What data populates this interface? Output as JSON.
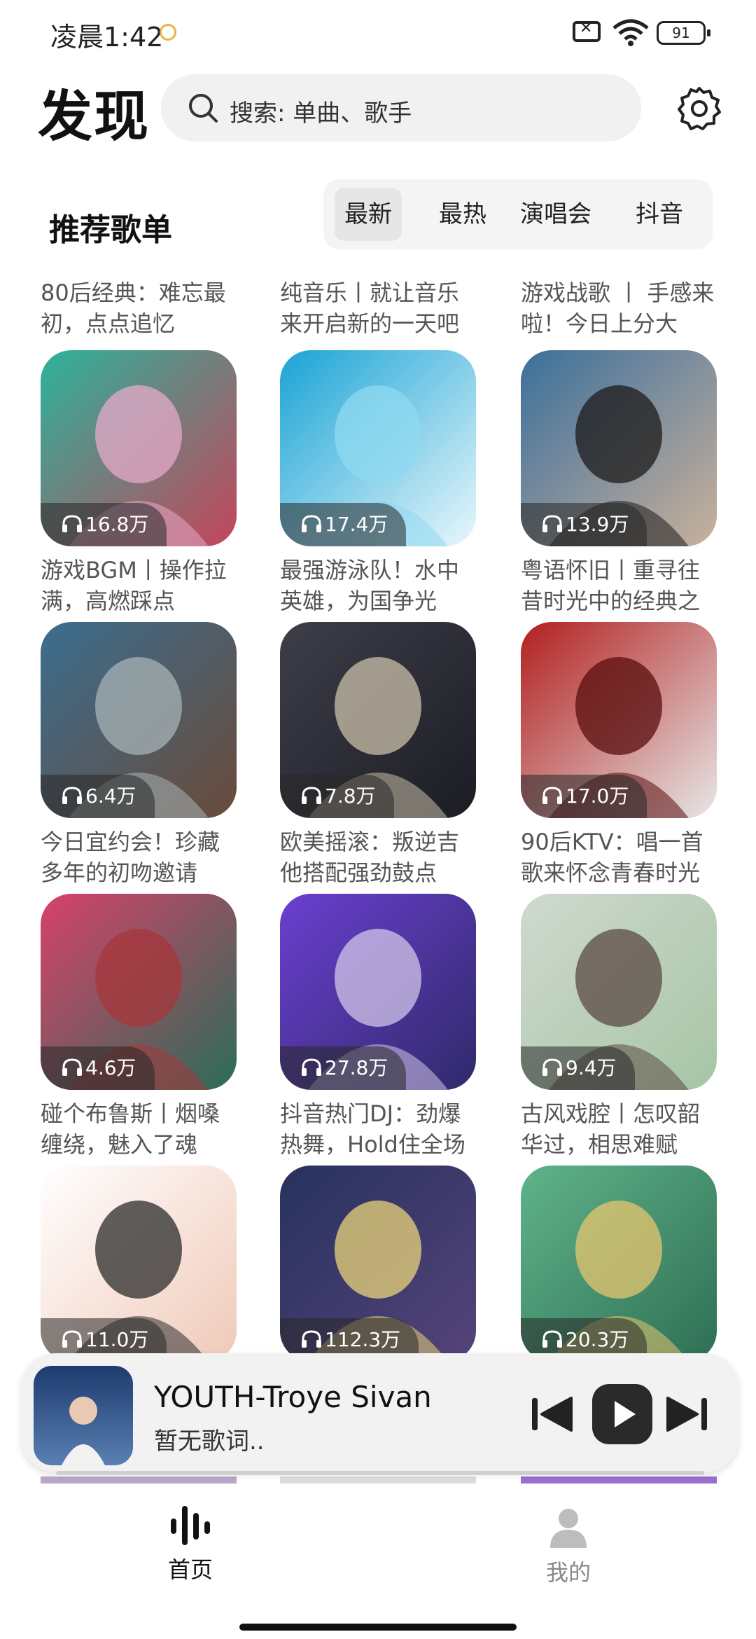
{
  "status_bar": {
    "time": "凌晨1:42",
    "battery": "91"
  },
  "header": {
    "title": "发现",
    "search_placeholder": "搜索: 单曲、歌手"
  },
  "section": {
    "title": "推荐歌单",
    "tabs": [
      {
        "label": "最新",
        "active": true
      },
      {
        "label": "最热",
        "active": false
      },
      {
        "label": "演唱会",
        "active": false
      },
      {
        "label": "抖音",
        "active": false
      }
    ]
  },
  "top_partial_row": [
    {
      "caption": "80后经典：难忘最初，点点追忆"
    },
    {
      "caption": "纯音乐丨就让音乐来开启新的一天吧"
    },
    {
      "caption": "游戏战歌 丨 手感来啦！今日上分大"
    }
  ],
  "playlists": [
    {
      "plays": "16.8万",
      "caption": "游戏BGM丨操作拉满，高燃踩点",
      "colors": [
        "#2bb39b",
        "#e6a9c9",
        "#c4455b"
      ]
    },
    {
      "plays": "17.4万",
      "caption": "最强游泳队！水中英雄，为国争光",
      "colors": [
        "#1aa3d6",
        "#8fd9f0",
        "#e9f7fb"
      ]
    },
    {
      "plays": "13.9万",
      "caption": "粤语怀旧丨重寻往昔时光中的经典之",
      "colors": [
        "#3b6f9c",
        "#1e1b1b",
        "#c9b19c"
      ]
    },
    {
      "plays": "6.4万",
      "caption": "今日宜约会！珍藏多年的初吻邀请",
      "colors": [
        "#3a6e8f",
        "#a7b3b5",
        "#6a4a3a"
      ]
    },
    {
      "plays": "7.8万",
      "caption": "欧美摇滚：叛逆吉他搭配强劲鼓点",
      "colors": [
        "#3e3e4a",
        "#c9bfa8",
        "#1c1c24"
      ]
    },
    {
      "plays": "17.0万",
      "caption": "90后KTV：唱一首歌来怀念青春时光",
      "colors": [
        "#b21f1f",
        "#5a0d0d",
        "#e7e7e7"
      ]
    },
    {
      "plays": "4.6万",
      "caption": "碰个布鲁斯丨烟嗓缠绕，魅入了魂",
      "colors": [
        "#d8416a",
        "#a5373b",
        "#2a6d58"
      ]
    },
    {
      "plays": "27.8万",
      "caption": "抖音热门DJ：劲爆热舞，Hold住全场",
      "colors": [
        "#6b3fd0",
        "#d1c6e8",
        "#2f2a6a"
      ]
    },
    {
      "plays": "9.4万",
      "caption": "古风戏腔丨怎叹韶华过，相思难赋",
      "colors": [
        "#cfd9cf",
        "#5b4a44",
        "#a7c5a5"
      ]
    },
    {
      "plays": "11.0万",
      "caption": "",
      "colors": [
        "#ffffff",
        "#2b2b2b",
        "#f0c9b8"
      ]
    },
    {
      "plays": "112.3万",
      "caption": "",
      "colors": [
        "#27325e",
        "#e9d47a",
        "#55437a"
      ]
    },
    {
      "plays": "20.3万",
      "caption": "",
      "colors": [
        "#5fb38a",
        "#e6c56d",
        "#2f6f55"
      ]
    }
  ],
  "player": {
    "song": "YOUTH-Troye Sivan",
    "lyric": "暂无歌词..",
    "progress": 0
  },
  "nav": [
    {
      "label": "首页",
      "active": true
    },
    {
      "label": "我的",
      "active": false
    }
  ]
}
